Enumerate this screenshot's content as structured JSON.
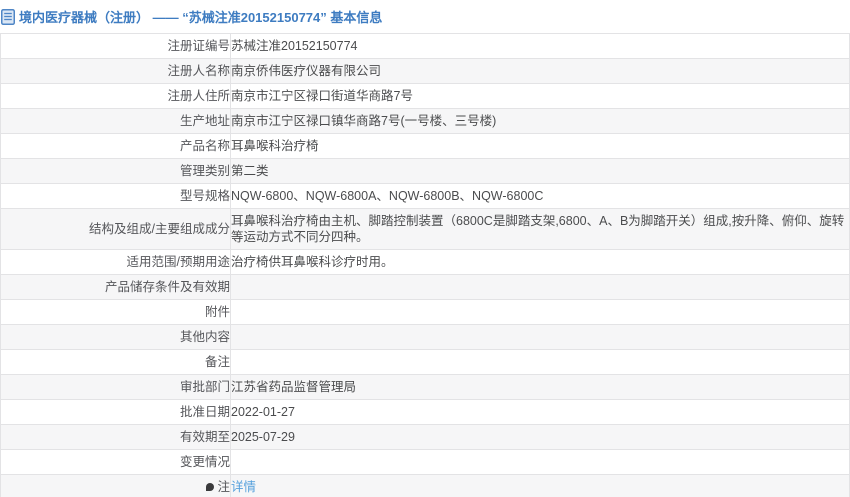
{
  "header": {
    "title": "境内医疗器械（注册） —— “苏械注准20152150774” 基本信息",
    "icon": "document-icon"
  },
  "colors": {
    "title_blue": "#3e7cc1",
    "link_blue": "#55a0dc",
    "row_stripe": "#f6f6f7",
    "border": "#e3e3e5",
    "label_text": "#55565a",
    "value_text": "#4b4c4e"
  },
  "table": {
    "rows": [
      {
        "label": "注册证编号",
        "value": "苏械注准20152150774"
      },
      {
        "label": "注册人名称",
        "value": "南京侨伟医疗仪器有限公司"
      },
      {
        "label": "注册人住所",
        "value": "南京市江宁区禄口街道华商路7号"
      },
      {
        "label": "生产地址",
        "value": "南京市江宁区禄口镇华商路7号(一号楼、三号楼)"
      },
      {
        "label": "产品名称",
        "value": "耳鼻喉科治疗椅"
      },
      {
        "label": "管理类别",
        "value": "第二类"
      },
      {
        "label": "型号规格",
        "value": "NQW-6800、NQW-6800A、NQW-6800B、NQW-6800C"
      },
      {
        "label": "结构及组成/主要组成成分",
        "value": "耳鼻喉科治疗椅由主机、脚踏控制装置（6800C是脚踏支架,6800、A、B为脚踏开关）组成,按升降、俯仰、旋转等运动方式不同分四种。"
      },
      {
        "label": "适用范围/预期用途",
        "value": "治疗椅供耳鼻喉科诊疗时用。"
      },
      {
        "label": "产品储存条件及有效期",
        "value": ""
      },
      {
        "label": "附件",
        "value": ""
      },
      {
        "label": "其他内容",
        "value": ""
      },
      {
        "label": "备注",
        "value": ""
      },
      {
        "label": "审批部门",
        "value": "江苏省药品监督管理局"
      },
      {
        "label": "批准日期",
        "value": "2022-01-27"
      },
      {
        "label": "有效期至",
        "value": "2025-07-29"
      },
      {
        "label": "变更情况",
        "value": ""
      },
      {
        "label": "注",
        "value": "详情",
        "label_icon": "pin-icon",
        "value_is_link": true
      }
    ]
  }
}
